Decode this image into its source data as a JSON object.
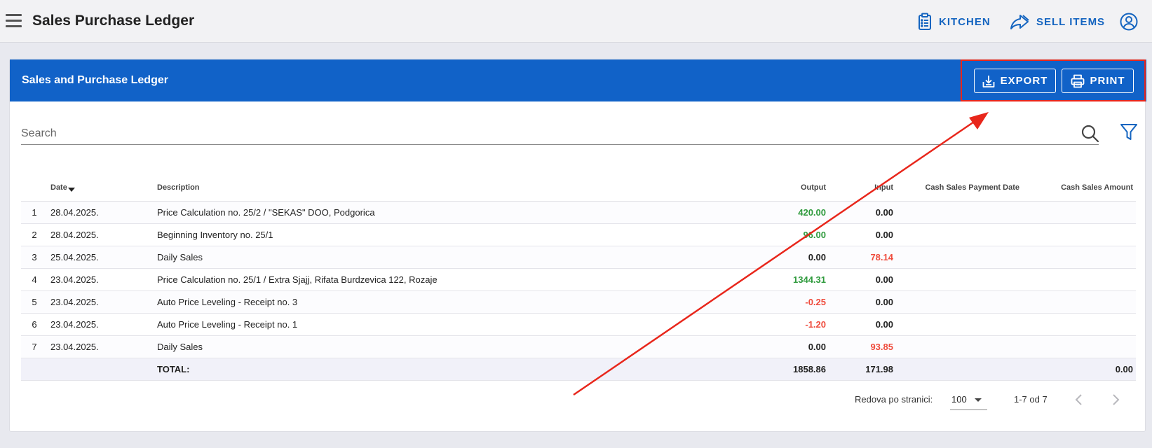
{
  "appbar": {
    "title": "Sales Purchase Ledger",
    "kitchen_label": "KITCHEN",
    "sell_label": "SELL ITEMS"
  },
  "card": {
    "title": "Sales and Purchase Ledger",
    "export_label": "EXPORT",
    "print_label": "PRINT"
  },
  "search": {
    "placeholder": "Search"
  },
  "table": {
    "columns": {
      "date": "Date",
      "description": "Description",
      "output": "Output",
      "input": "Input",
      "cash_date": "Cash Sales Payment Date",
      "cash_amount": "Cash Sales Amount"
    },
    "rows": [
      {
        "idx": "1",
        "date": "28.04.2025.",
        "description": "Price Calculation no. 25/2 / \"SEKAS\" DOO, Podgorica",
        "output": "420.00",
        "input": "0.00"
      },
      {
        "idx": "2",
        "date": "28.04.2025.",
        "description": "Beginning Inventory no. 25/1",
        "output": "96.00",
        "input": "0.00"
      },
      {
        "idx": "3",
        "date": "25.04.2025.",
        "description": "Daily Sales",
        "output": "0.00",
        "input": "78.14"
      },
      {
        "idx": "4",
        "date": "23.04.2025.",
        "description": "Price Calculation no. 25/1 / Extra Sjajj, Rifata Burdzevica 122, Rozaje",
        "output": "1344.31",
        "input": "0.00"
      },
      {
        "idx": "5",
        "date": "23.04.2025.",
        "description": "Auto Price Leveling - Receipt no. 3",
        "output": "-0.25",
        "input": "0.00"
      },
      {
        "idx": "6",
        "date": "23.04.2025.",
        "description": "Auto Price Leveling - Receipt no. 1",
        "output": "-1.20",
        "input": "0.00"
      },
      {
        "idx": "7",
        "date": "23.04.2025.",
        "description": "Daily Sales",
        "output": "0.00",
        "input": "93.85"
      }
    ],
    "total": {
      "label": "TOTAL:",
      "output": "1858.86",
      "input": "171.98",
      "cash_amount": "0.00"
    }
  },
  "pagination": {
    "rows_label": "Redova po stranici:",
    "rows_value": "100",
    "range": "1-7 od 7"
  },
  "colors": {
    "primary": "#1162c8",
    "positive": "#2e9a3c",
    "negative": "#ef4c3d",
    "annotation": "#e8261b"
  }
}
